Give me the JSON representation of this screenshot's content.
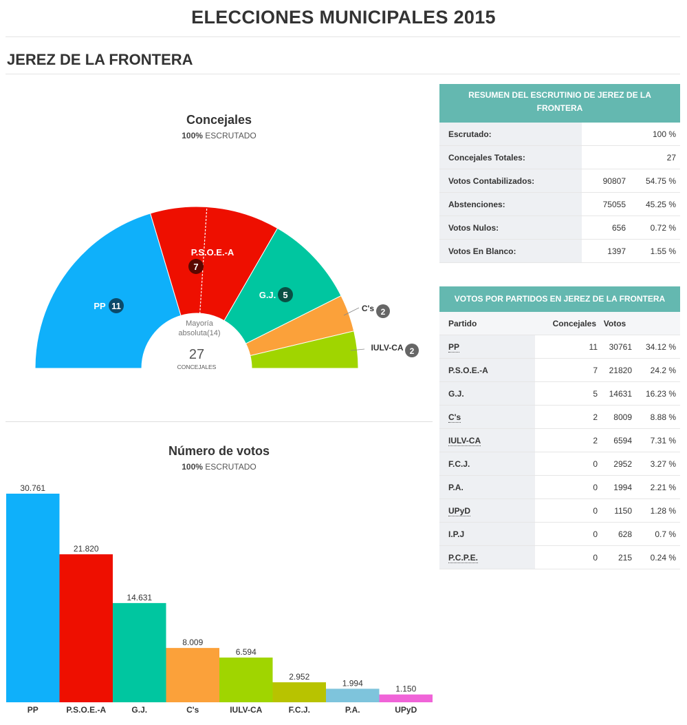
{
  "page": {
    "title": "ELECCIONES MUNICIPALES 2015",
    "municipality": "JEREZ DE LA FRONTERA"
  },
  "seats_section": {
    "title": "Concejales",
    "scrutiny_value": "100%",
    "scrutiny_label": "ESCRUTADO",
    "majority_line1": "Mayoría",
    "majority_line2": "absoluta(14)",
    "total_seats": "27",
    "total_label": "CONCEJALES"
  },
  "votes_section": {
    "title": "Número de votos",
    "scrutiny_value": "100%",
    "scrutiny_label": "ESCRUTADO"
  },
  "chart_data": [
    {
      "type": "pie",
      "subtype": "half-donut parliament chart",
      "title": "Concejales",
      "total": 27,
      "majority": 14,
      "slices": [
        {
          "name": "PP",
          "value": 11,
          "color": "#0fb0fa"
        },
        {
          "name": "P.S.O.E.-A",
          "value": 7,
          "color": "#ee0f00"
        },
        {
          "name": "G.J.",
          "value": 5,
          "color": "#00c6a0"
        },
        {
          "name": "C's",
          "value": 2,
          "color": "#fba13a"
        },
        {
          "name": "IULV-CA",
          "value": 2,
          "color": "#a0d500"
        }
      ]
    },
    {
      "type": "bar",
      "title": "Número de votos",
      "categories": [
        "PP",
        "P.S.O.E.-A",
        "G.J.",
        "C's",
        "IULV-CA",
        "F.C.J.",
        "P.A.",
        "UPyD"
      ],
      "values": [
        30761,
        21820,
        14631,
        8009,
        6594,
        2952,
        1994,
        1150
      ],
      "value_labels": [
        "30.761",
        "21.820",
        "14.631",
        "8.009",
        "6.594",
        "2.952",
        "1.994",
        "1.150"
      ],
      "colors": [
        "#0fb0fa",
        "#ee0f00",
        "#00c6a0",
        "#fba13a",
        "#a0d500",
        "#b8c300",
        "#7ec4dc",
        "#f064d8"
      ],
      "ylim": [
        0,
        30761
      ]
    }
  ],
  "summary_table": {
    "title": "RESUMEN DEL ESCRUTINIO DE JEREZ DE LA FRONTERA",
    "rows": [
      {
        "label": "Escrutado:",
        "value": "",
        "pct": "100 %"
      },
      {
        "label": "Concejales Totales:",
        "value": "",
        "pct": "27"
      },
      {
        "label": "Votos Contabilizados:",
        "value": "90807",
        "pct": "54.75 %"
      },
      {
        "label": "Abstenciones:",
        "value": "75055",
        "pct": "45.25 %"
      },
      {
        "label": "Votos Nulos:",
        "value": "656",
        "pct": "0.72 %"
      },
      {
        "label": "Votos En Blanco:",
        "value": "1397",
        "pct": "1.55 %"
      }
    ]
  },
  "party_table": {
    "title": "VOTOS POR PARTIDOS EN JEREZ DE LA FRONTERA",
    "headers": {
      "party": "Partido",
      "seats": "Concejales",
      "votes": "Votos"
    },
    "rows": [
      {
        "party": "PP",
        "seats": "11",
        "votes": "30761",
        "pct": "34.12 %",
        "link": true
      },
      {
        "party": "P.S.O.E.-A",
        "seats": "7",
        "votes": "21820",
        "pct": "24.2 %",
        "link": false
      },
      {
        "party": "G.J.",
        "seats": "5",
        "votes": "14631",
        "pct": "16.23 %",
        "link": false
      },
      {
        "party": "C's",
        "seats": "2",
        "votes": "8009",
        "pct": "8.88 %",
        "link": true
      },
      {
        "party": "IULV-CA",
        "seats": "2",
        "votes": "6594",
        "pct": "7.31 %",
        "link": true
      },
      {
        "party": "F.C.J.",
        "seats": "0",
        "votes": "2952",
        "pct": "3.27 %",
        "link": false
      },
      {
        "party": "P.A.",
        "seats": "0",
        "votes": "1994",
        "pct": "2.21 %",
        "link": false
      },
      {
        "party": "UPyD",
        "seats": "0",
        "votes": "1150",
        "pct": "1.28 %",
        "link": true
      },
      {
        "party": "I.P.J",
        "seats": "0",
        "votes": "628",
        "pct": "0.7 %",
        "link": false
      },
      {
        "party": "P.C.P.E.",
        "seats": "0",
        "votes": "215",
        "pct": "0.24 %",
        "link": true
      }
    ]
  }
}
